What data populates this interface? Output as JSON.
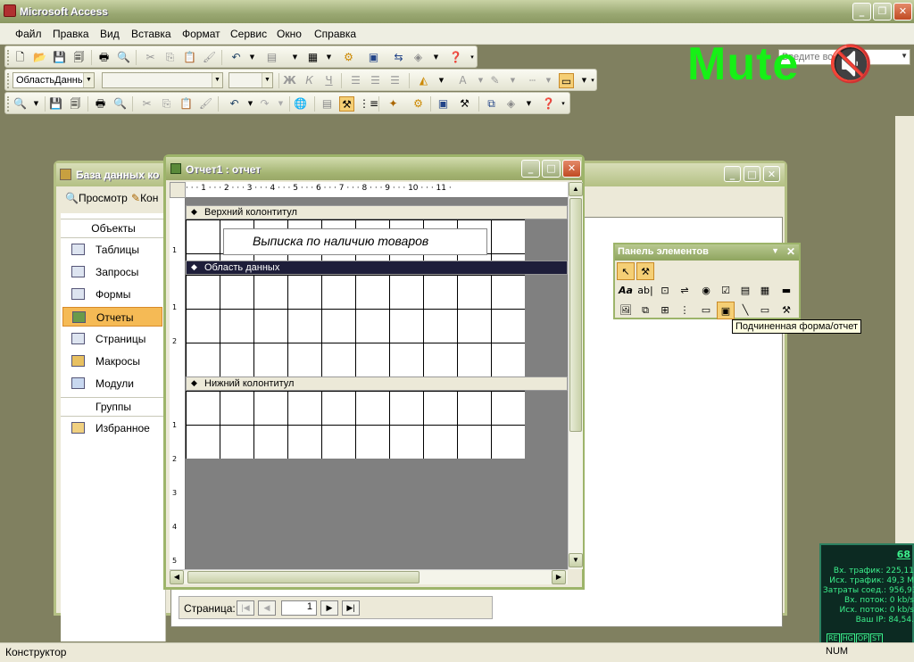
{
  "app": {
    "title": "Microsoft Access"
  },
  "menu": {
    "items": [
      "Файл",
      "Правка",
      "Вид",
      "Вставка",
      "Формат",
      "Сервис",
      "Окно",
      "Справка"
    ],
    "ask_placeholder": "Введите вопрос"
  },
  "format_toolbar": {
    "object_combo": "ОбластьДанны",
    "font_combo": "",
    "size_combo": ""
  },
  "overlay": {
    "mute_text": "Mute",
    "mute_symbol": "🔇"
  },
  "db_window": {
    "title": "База данных ко",
    "toolbar": {
      "preview": "Просмотр",
      "constructor": "Кон"
    },
    "objects_header": "Объекты",
    "objects": [
      {
        "label": "Таблицы",
        "icon": "table-icon"
      },
      {
        "label": "Запросы",
        "icon": "query-icon"
      },
      {
        "label": "Формы",
        "icon": "form-icon"
      },
      {
        "label": "Отчеты",
        "icon": "report-icon"
      },
      {
        "label": "Страницы",
        "icon": "page-icon"
      },
      {
        "label": "Макросы",
        "icon": "macro-icon"
      },
      {
        "label": "Модули",
        "icon": "module-icon"
      }
    ],
    "groups_header": "Группы",
    "groups": [
      {
        "label": "Избранное",
        "icon": "favorites-icon"
      }
    ]
  },
  "report_window": {
    "title": "Отчет1 : отчет",
    "ruler_marks": [
      "1",
      "2",
      "3",
      "4",
      "5",
      "6",
      "7",
      "8",
      "9",
      "10",
      "11"
    ],
    "vruler_marks": {
      "header": [
        "1"
      ],
      "detail": [
        "1",
        "2"
      ],
      "footer": [
        "1",
        "2",
        "3",
        "4",
        "5"
      ]
    },
    "sections": {
      "header": "Верхний колонтитул",
      "detail": "Область данных",
      "footer": "Нижний колонтитул"
    },
    "title_label": "Выписка по наличию товаров"
  },
  "page_nav": {
    "label": "Страница:",
    "page": "1"
  },
  "toolbox": {
    "title": "Панель элементов",
    "tooltip": "Подчиненная форма/отчет"
  },
  "status": {
    "text": "Конструктор",
    "num": "NUM"
  },
  "netmon": {
    "value": "68",
    "rows": [
      {
        "label": "Вх. трафик:",
        "value": "225,11"
      },
      {
        "label": "Исх. трафик:",
        "value": "49,3 M"
      },
      {
        "label": "Затраты соед.:",
        "value": "956,93"
      },
      {
        "label": "Вх. поток:",
        "value": "0 kb/s"
      },
      {
        "label": "Исх. поток:",
        "value": "0 kb/s"
      },
      {
        "label": "Ваш IP:",
        "value": "84,54."
      }
    ],
    "buttons": [
      "RE",
      "HG",
      "OP",
      "ST"
    ]
  }
}
